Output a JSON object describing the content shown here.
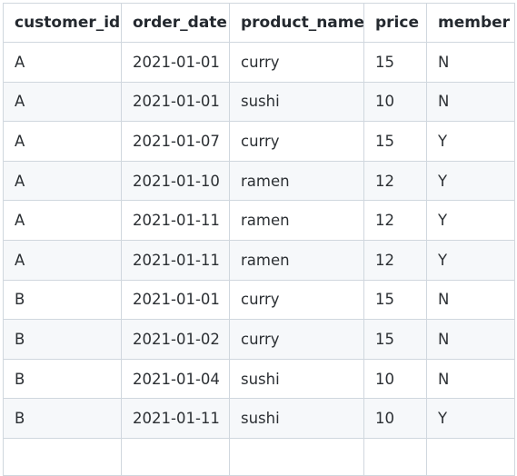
{
  "table": {
    "columns": [
      "customer_id",
      "order_date",
      "product_name",
      "price",
      "member"
    ],
    "rows": [
      [
        "A",
        "2021-01-01",
        "curry",
        "15",
        "N"
      ],
      [
        "A",
        "2021-01-01",
        "sushi",
        "10",
        "N"
      ],
      [
        "A",
        "2021-01-07",
        "curry",
        "15",
        "Y"
      ],
      [
        "A",
        "2021-01-10",
        "ramen",
        "12",
        "Y"
      ],
      [
        "A",
        "2021-01-11",
        "ramen",
        "12",
        "Y"
      ],
      [
        "A",
        "2021-01-11",
        "ramen",
        "12",
        "Y"
      ],
      [
        "B",
        "2021-01-01",
        "curry",
        "15",
        "N"
      ],
      [
        "B",
        "2021-01-02",
        "curry",
        "15",
        "N"
      ],
      [
        "B",
        "2021-01-04",
        "sushi",
        "10",
        "N"
      ],
      [
        "B",
        "2021-01-11",
        "sushi",
        "10",
        "Y"
      ],
      [
        "",
        "",
        "",
        "",
        ""
      ]
    ]
  },
  "colors": {
    "border": "#d0d7de",
    "stripe": "#f6f8fa",
    "text": "#24292f"
  }
}
